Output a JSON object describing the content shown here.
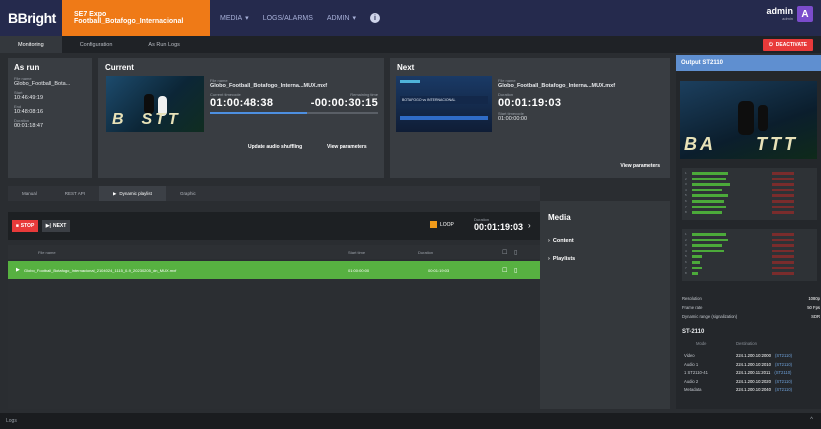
{
  "header": {
    "logo": "BBright",
    "channel": "SE7 Expo Football_Botafogo_Internacional",
    "nav": [
      {
        "label": "MEDIA",
        "caret": "▾"
      },
      {
        "label": "LOGS/ALARMS",
        "caret": ""
      },
      {
        "label": "ADMIN",
        "caret": "▾"
      }
    ],
    "user": "admin",
    "user_sub": "admin",
    "avatar": "A"
  },
  "subnav": {
    "tabs": [
      "Monitoring",
      "Configuration",
      "As Run Logs"
    ],
    "deactivate": "DEACTIVATE"
  },
  "as_run": {
    "title": "As run",
    "file_label": "File name",
    "file": "Globo_Football_Bota...",
    "start_label": "Start",
    "start": "10:46:49:19",
    "end_label": "End",
    "end": "10:48:08:16",
    "duration_label": "Duration",
    "duration": "00:01:18:47"
  },
  "current": {
    "title": "Current",
    "file_label": "File name",
    "file": "Globo_Football_Botafogo_Interna...MUX.mxf",
    "cur_label": "Current timecode",
    "cur": "01:00:48:38",
    "rem_label": "Remaining time",
    "rem": "-00:00:30:15",
    "progress": 0.58,
    "btn_audio": "Update audio shuffling",
    "btn_params": "View parameters"
  },
  "next": {
    "title": "Next",
    "file_label": "File name",
    "file": "Globo_Football_Botafogo_Interna...MUX.mxf",
    "dur_label": "Duration",
    "dur": "00:01:19:03",
    "start_label": "Start timecode",
    "start": "01:00:00:00",
    "btn_params": "View parameters"
  },
  "tabs": [
    "Manual",
    "REST API",
    "Dynamic playlist",
    "Graphic"
  ],
  "toolbar": {
    "stop": "STOP",
    "next": "NEXT",
    "loop": "LOOP",
    "duration_label": "Duration",
    "duration": "00:01:19:03"
  },
  "playlist": {
    "headers": [
      "File name",
      "Start time",
      "Duration"
    ],
    "row": {
      "file": "Globo_Football_Botafogo_Internacional_2104024_1115_0-9_20230205_dn_MUX.mxf",
      "start": "01:00:00:00",
      "duration": "00:01:19:03"
    }
  },
  "media": {
    "title": "Media",
    "items": [
      "Content",
      "Playlists"
    ]
  },
  "output": {
    "title": "Output ST2110",
    "stats": [
      {
        "k": "Resolution",
        "v": "1080p"
      },
      {
        "k": "Frame rate",
        "v": "50 Fps"
      },
      {
        "k": "Dynamic range (signalization)",
        "v": "SDR"
      }
    ],
    "st_title": "ST-2110",
    "st_headers": [
      "Mode",
      "Destination"
    ],
    "st_rows": [
      {
        "k": "Video",
        "ip": "224.1.200.10:2000",
        "tag": "(ST2110)"
      },
      {
        "k": "Audio 1",
        "ip": "224.1.200.10:2010",
        "tag": "(ST2110)"
      },
      {
        "k": "1 ST2110-41",
        "ip": "224.1.200.11:2011",
        "tag": "(ST2110)"
      },
      {
        "k": "Audio 2",
        "ip": "224.1.200.10:2020",
        "tag": "(ST2110)"
      },
      {
        "k": "Metadata",
        "ip": "224.1.200.10:2040",
        "tag": "(ST2110)"
      }
    ]
  },
  "footer": {
    "label": "Logs",
    "arrow": "^"
  },
  "colors": {
    "accent": "#ef7a17",
    "playing": "#57b141",
    "stop": "#e83a3a",
    "topbar": "#252a4d",
    "output": "#5f8fd0"
  }
}
